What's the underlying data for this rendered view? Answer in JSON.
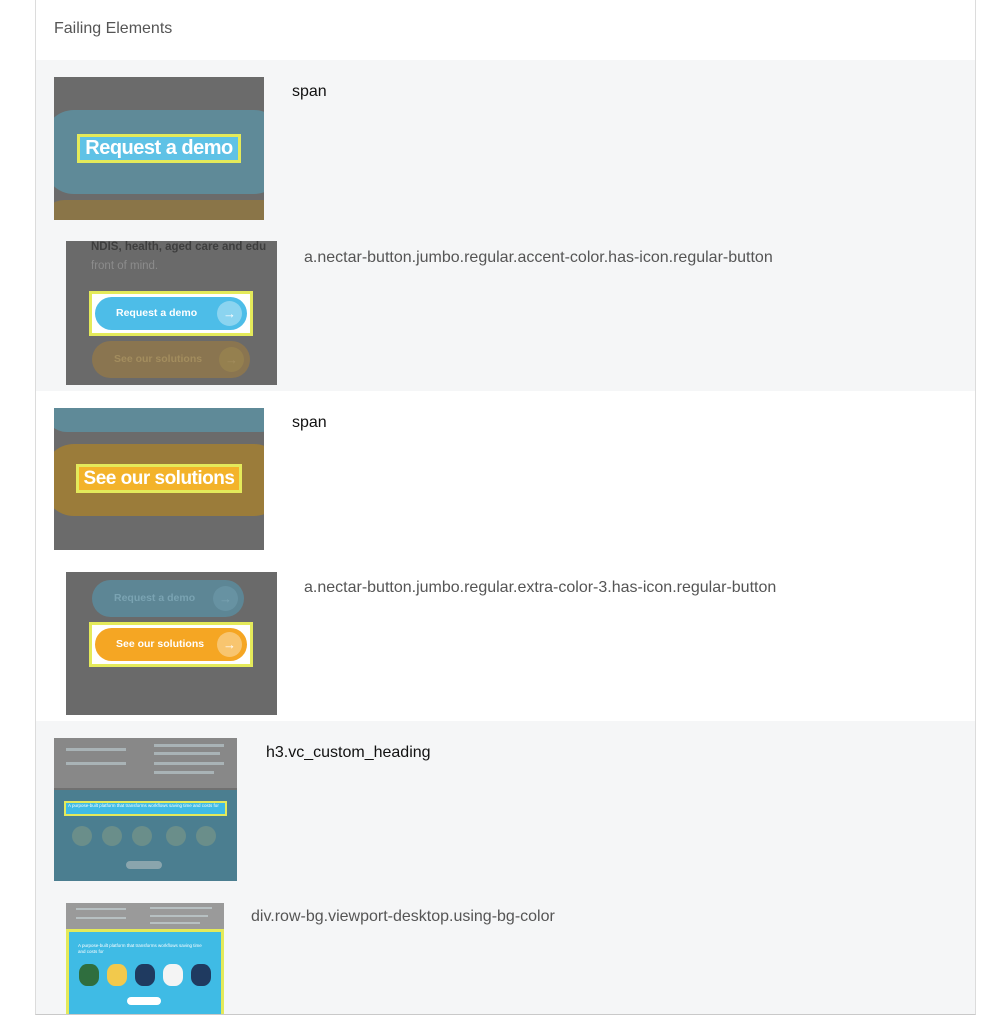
{
  "panel": {
    "title": "Failing Elements"
  },
  "groups": [
    {
      "element_label": "span",
      "target_label": "a.nectar-button.jumbo.regular.accent-color.has-icon.regular-button",
      "thumb1": {
        "text": "Request a demo"
      },
      "thumb2": {
        "caption_line1": "NDIS, health, aged care and edu",
        "caption_line2": "front of mind.",
        "button_primary": "Request a demo",
        "button_secondary": "See our solutions"
      }
    },
    {
      "element_label": "span",
      "target_label": "a.nectar-button.jumbo.regular.extra-color-3.has-icon.regular-button",
      "thumb1": {
        "text": "See our solutions"
      },
      "thumb2": {
        "button_secondary": "Request a demo",
        "button_primary": "See our solutions"
      }
    },
    {
      "element_label": "h3.vc_custom_heading",
      "target_label": "div.row-bg.viewport-desktop.using-bg-color",
      "thumb1": {
        "text": "A purpose-built platform that transforms workflows saving time and costs for"
      },
      "thumb2": {
        "text": "A purpose-built platform that transforms workflows saving time and costs for"
      }
    }
  ],
  "colors": {
    "highlight": "#e4ea5a",
    "accent_blue": "#4dbde8",
    "extra_orange": "#f5a623",
    "shaded_row": "#f5f6f7"
  },
  "icons": {
    "arrow": "arrow-right-icon"
  }
}
